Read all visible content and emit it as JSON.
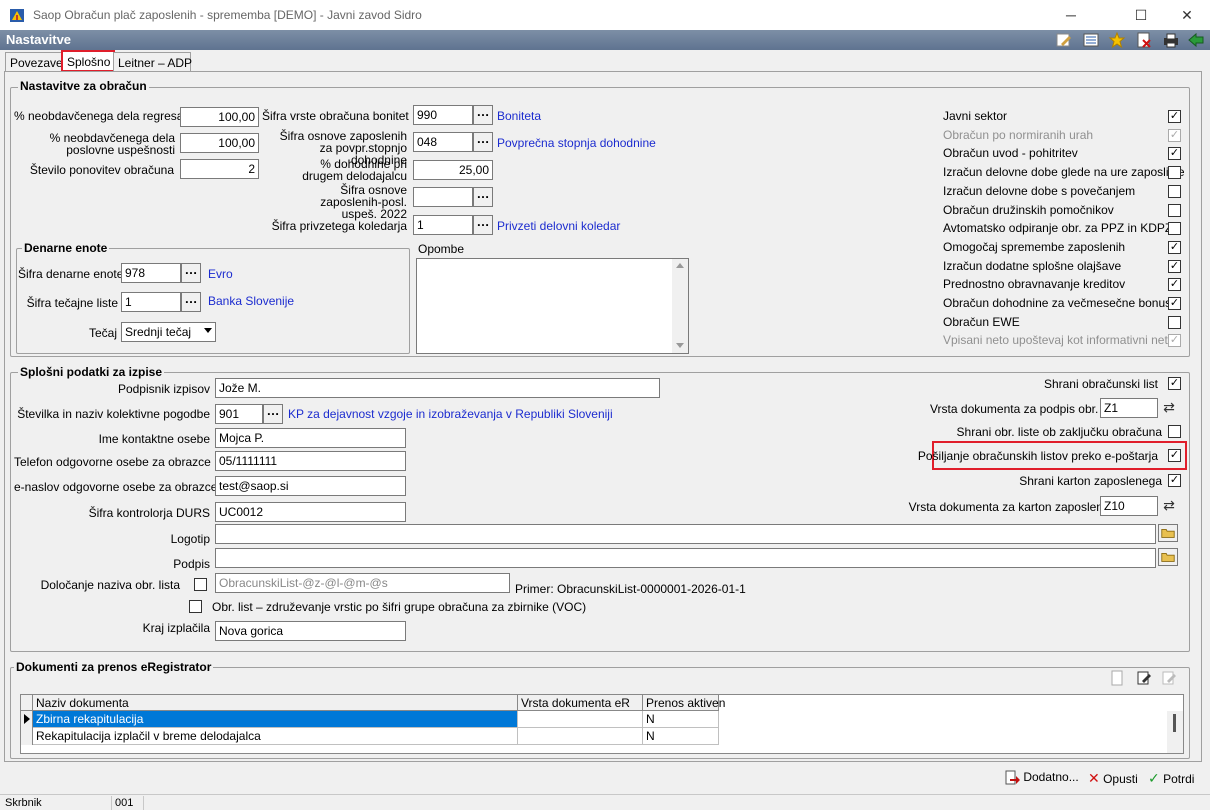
{
  "window": {
    "title": "Saop Obračun plač zaposlenih - sprememba [DEMO] - Javni zavod Sidro",
    "header": "Nastavitve"
  },
  "tabs": [
    "Povezave",
    "Splošno",
    "Leitner – ADP"
  ],
  "obracun": {
    "title": "Nastavitve za obračun",
    "neobd_regresa_label": "% neobdavčenega dela regresa",
    "neobd_regresa": "100,00",
    "neobd_uspesnosti_label": "% neobdavčenega dela poslovne uspešnosti",
    "neobd_uspesnosti": "100,00",
    "ponovitev_label": "Število ponovitev obračuna",
    "ponovitev": "2",
    "bonitet_label": "Šifra vrste obračuna bonitet",
    "bonitet": "990",
    "bonitet_link": "Boniteta",
    "osnove_label": "Šifra osnove zaposlenih za povpr.stopnjo dohodnine",
    "osnove": "048",
    "osnove_link": "Povprečna stopnja dohodnine",
    "dohodnine_label": "% dohodnine pri drugem delodajalcu",
    "dohodnine": "25,00",
    "osnove2022_label": "Šifra osnove zaposlenih-posl. uspeš. 2022",
    "osnove2022": "",
    "koledar_label": "Šifra privzetega koledarja",
    "koledar": "1",
    "koledar_link": "Privzeti delovni koledar",
    "checks": [
      {
        "label": "Javni sektor",
        "state": "✓",
        "disabled": false
      },
      {
        "label": "Obračun po normiranih urah",
        "state": "✓",
        "disabled": true
      },
      {
        "label": "Obračun uvod - pohitritev",
        "state": "✓",
        "disabled": false
      },
      {
        "label": "Izračun delovne dobe glede na ure zaposlitve",
        "state": "",
        "disabled": false
      },
      {
        "label": "Izračun delovne dobe s povečanjem",
        "state": "",
        "disabled": false
      },
      {
        "label": "Obračun družinskih pomočnikov",
        "state": "",
        "disabled": false
      },
      {
        "label": "Avtomatsko odpiranje obr. za PPZ in KDPZ",
        "state": "",
        "disabled": false
      },
      {
        "label": "Omogočaj spremembe zaposlenih",
        "state": "✓",
        "disabled": false
      },
      {
        "label": "Izračun dodatne splošne olajšave",
        "state": "✓",
        "disabled": false
      },
      {
        "label": "Prednostno obravnavanje kreditov",
        "state": "✓",
        "disabled": false
      },
      {
        "label": "Obračun dohodnine za večmesečne bonuse",
        "state": "✓",
        "disabled": false
      },
      {
        "label": "Obračun EWE",
        "state": "",
        "disabled": false
      },
      {
        "label": "Vpisani neto upoštevaj kot informativni neto",
        "state": "✓",
        "disabled": true
      }
    ]
  },
  "denarne": {
    "title": "Denarne enote",
    "enota_label": "Šifra denarne enote",
    "enota": "978",
    "enota_link": "Evro",
    "tecajna_label": "Šifra tečajne liste",
    "tecajna": "1",
    "tecajna_link": "Banka Slovenije",
    "tecaj_label": "Tečaj",
    "tecaj": "Srednji tečaj"
  },
  "opombe_label": "Opombe",
  "izpisi": {
    "title": "Splošni podatki za izpise",
    "podpisnik_label": "Podpisnik izpisov",
    "podpisnik": "Jože M.",
    "kolektivna_label": "Številka in naziv kolektivne pogodbe",
    "kolektivna": "901",
    "kolektivna_link": "KP za dejavnost vzgoje in izobraževanja v Republiki Sloveniji",
    "kontakt_label": "Ime kontaktne osebe",
    "kontakt": "Mojca P.",
    "telefon_label": "Telefon odgovorne osebe za obrazce",
    "telefon": "05/1111111",
    "email_label": "e-naslov odgovorne osebe za obrazce",
    "email": "test@saop.si",
    "durs_label": "Šifra kontrolorja DURS",
    "durs": "UC0012",
    "logotip_label": "Logotip",
    "podpis_label": "Podpis",
    "naziv_label": "Določanje naziva obr. lista",
    "naziv_value": "ObracunskiList-@z-@l-@m-@s",
    "primer": "Primer: ObracunskiList-0000001-2026-01-1",
    "voc_label": "Obr. list – združevanje vrstic po šifri grupe obračuna za zbirnike (VOC)",
    "kraj_label": "Kraj izplačila",
    "kraj": "Nova gorica",
    "shrani_list_label": "Shrani obračunski list",
    "vrsta_podpis_label": "Vrsta dokumenta za podpis obr. lista",
    "vrsta_podpis": "Z1",
    "shrani_zakljucku_label": "Shrani obr. liste ob zaključku obračuna",
    "posiljanje_label": "Pošiljanje obračunskih listov preko e-poštarja",
    "shrani_karton_label": "Shrani karton zaposlenega",
    "vrsta_karton_label": "Vrsta dokumenta za karton zaposlenega",
    "vrsta_karton": "Z10"
  },
  "dokumenti": {
    "title": "Dokumenti za prenos eRegistrator",
    "columns": [
      "Naziv dokumenta",
      "Vrsta dokumenta eR",
      "Prenos aktiven"
    ],
    "rows": [
      [
        "Zbirna rekapitulacija",
        "",
        "N"
      ],
      [
        "Rekapitulacija izplačil v breme delodajalca",
        "",
        "N"
      ]
    ]
  },
  "buttons": {
    "dodatno": "Dodatno...",
    "opusti": "Opusti",
    "potrdi": "Potrdi"
  },
  "status": {
    "user": "Skrbnik",
    "code": "001"
  },
  "colors": {
    "highlight_red": "#e01e2b",
    "link_blue": "#1c2ccf",
    "selection": "#0078d7"
  }
}
